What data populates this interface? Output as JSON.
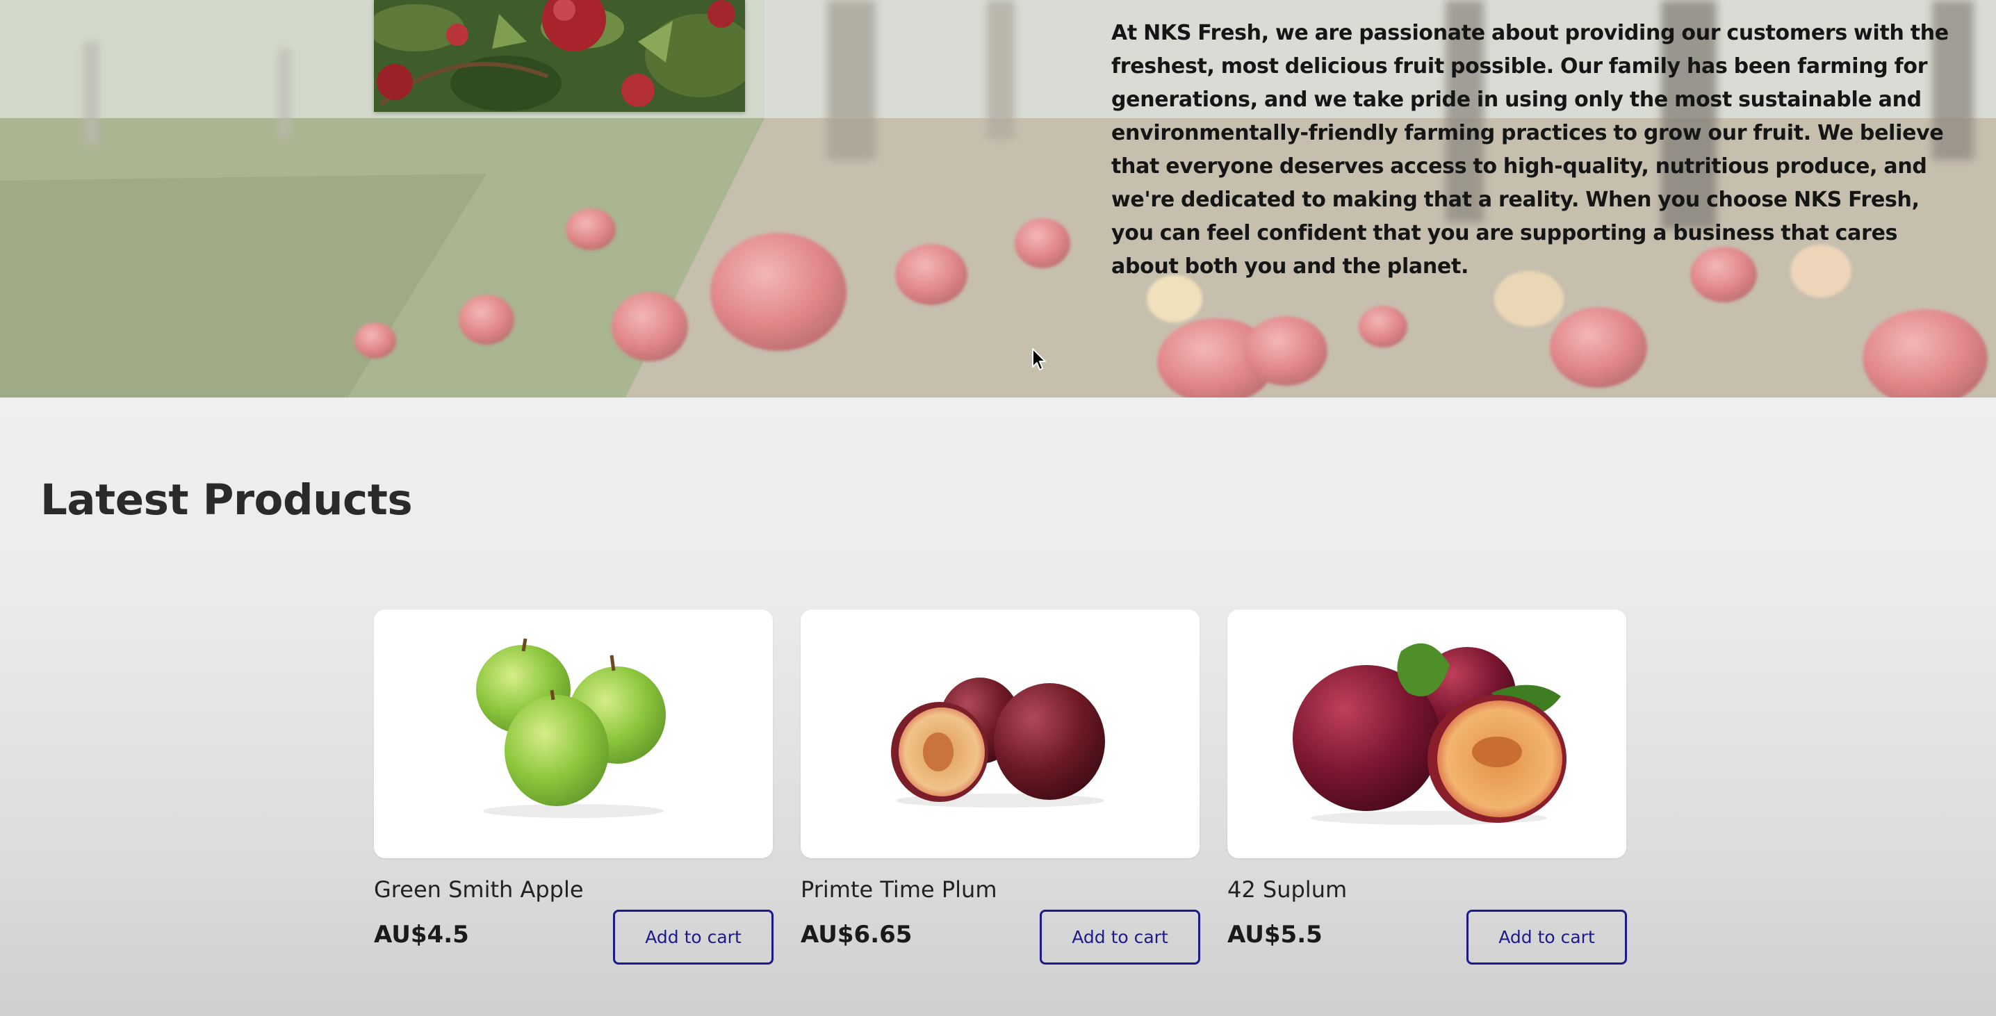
{
  "hero": {
    "about_text": "At NKS Fresh, we are passionate about providing our customers with the freshest, most delicious fruit possible. Our family has been farming for generations, and we take pride in using only the most sustainable and environmentally-friendly farming practices to grow our fruit. We believe that everyone deserves access to high-quality, nutritious produce, and we're dedicated to making that a reality. When you choose NKS Fresh, you can feel confident that you are supporting a business that cares about both you and the planet."
  },
  "products_section": {
    "title": "Latest Products",
    "items": [
      {
        "name": "Green Smith Apple",
        "price": "AU$4.5",
        "button_label": "Add to cart"
      },
      {
        "name": "Primte Time Plum",
        "price": "AU$6.65",
        "button_label": "Add to cart"
      },
      {
        "name": "42 Suplum",
        "price": "AU$5.5",
        "button_label": "Add to cart"
      }
    ]
  },
  "colors": {
    "accent": "#1d1a8c",
    "page_background": "#eeeeee",
    "card_background": "#ffffff"
  },
  "icons": [
    "mouse-cursor-icon"
  ]
}
